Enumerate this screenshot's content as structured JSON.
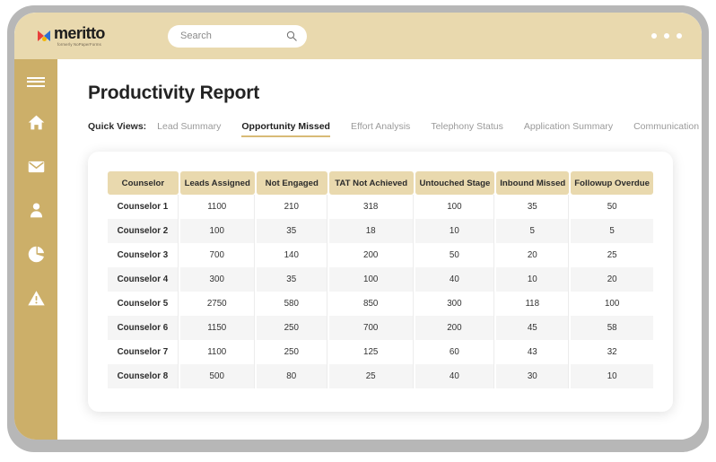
{
  "brand": {
    "wordmark": "meritto",
    "tagline": "formerly NoPaperForms",
    "logo_mark_icon": "meritto-logo-icon",
    "colors": {
      "topbar": "#e9d9ae",
      "sidebar": "#ccaf69",
      "accent": "#d8bb77",
      "frame": "#b7b7b7"
    }
  },
  "search": {
    "placeholder": "Search",
    "value": "",
    "icon": "search-icon"
  },
  "window_controls": {
    "dots": [
      "dot-1",
      "dot-2",
      "dot-3"
    ]
  },
  "sidebar": {
    "items": [
      {
        "icon": "hamburger-menu-icon",
        "label": "Menu"
      },
      {
        "icon": "home-icon",
        "label": "Home"
      },
      {
        "icon": "envelope-icon",
        "label": "Mail"
      },
      {
        "icon": "user-icon",
        "label": "Profile"
      },
      {
        "icon": "pie-chart-icon",
        "label": "Reports"
      },
      {
        "icon": "alert-triangle-icon",
        "label": "Alerts"
      }
    ]
  },
  "page": {
    "title": "Productivity Report"
  },
  "quick_views": {
    "label": "Quick Views:",
    "tabs": [
      {
        "label": "Lead Summary",
        "active": false
      },
      {
        "label": "Opportunity Missed",
        "active": true
      },
      {
        "label": "Effort Analysis",
        "active": false
      },
      {
        "label": "Telephony Status",
        "active": false
      },
      {
        "label": "Application Summary",
        "active": false
      },
      {
        "label": "Communication Status",
        "active": false
      }
    ],
    "overflow_arrows": [
      "»",
      "»"
    ]
  },
  "table": {
    "columns": [
      "Counselor",
      "Leads Assigned",
      "Not Engaged",
      "TAT Not Achieved",
      "Untouched Stage",
      "Inbound Missed",
      "Followup Overdue"
    ],
    "rows": [
      [
        "Counselor 1",
        "1100",
        "210",
        "318",
        "100",
        "35",
        "50"
      ],
      [
        "Counselor 2",
        "100",
        "35",
        "18",
        "10",
        "5",
        "5"
      ],
      [
        "Counselor 3",
        "700",
        "140",
        "200",
        "50",
        "20",
        "25"
      ],
      [
        "Counselor 4",
        "300",
        "35",
        "100",
        "40",
        "10",
        "20"
      ],
      [
        "Counselor 5",
        "2750",
        "580",
        "850",
        "300",
        "118",
        "100"
      ],
      [
        "Counselor 6",
        "1150",
        "250",
        "700",
        "200",
        "45",
        "58"
      ],
      [
        "Counselor 7",
        "1100",
        "250",
        "125",
        "60",
        "43",
        "32"
      ],
      [
        "Counselor 8",
        "500",
        "80",
        "25",
        "40",
        "30",
        "10"
      ]
    ]
  }
}
